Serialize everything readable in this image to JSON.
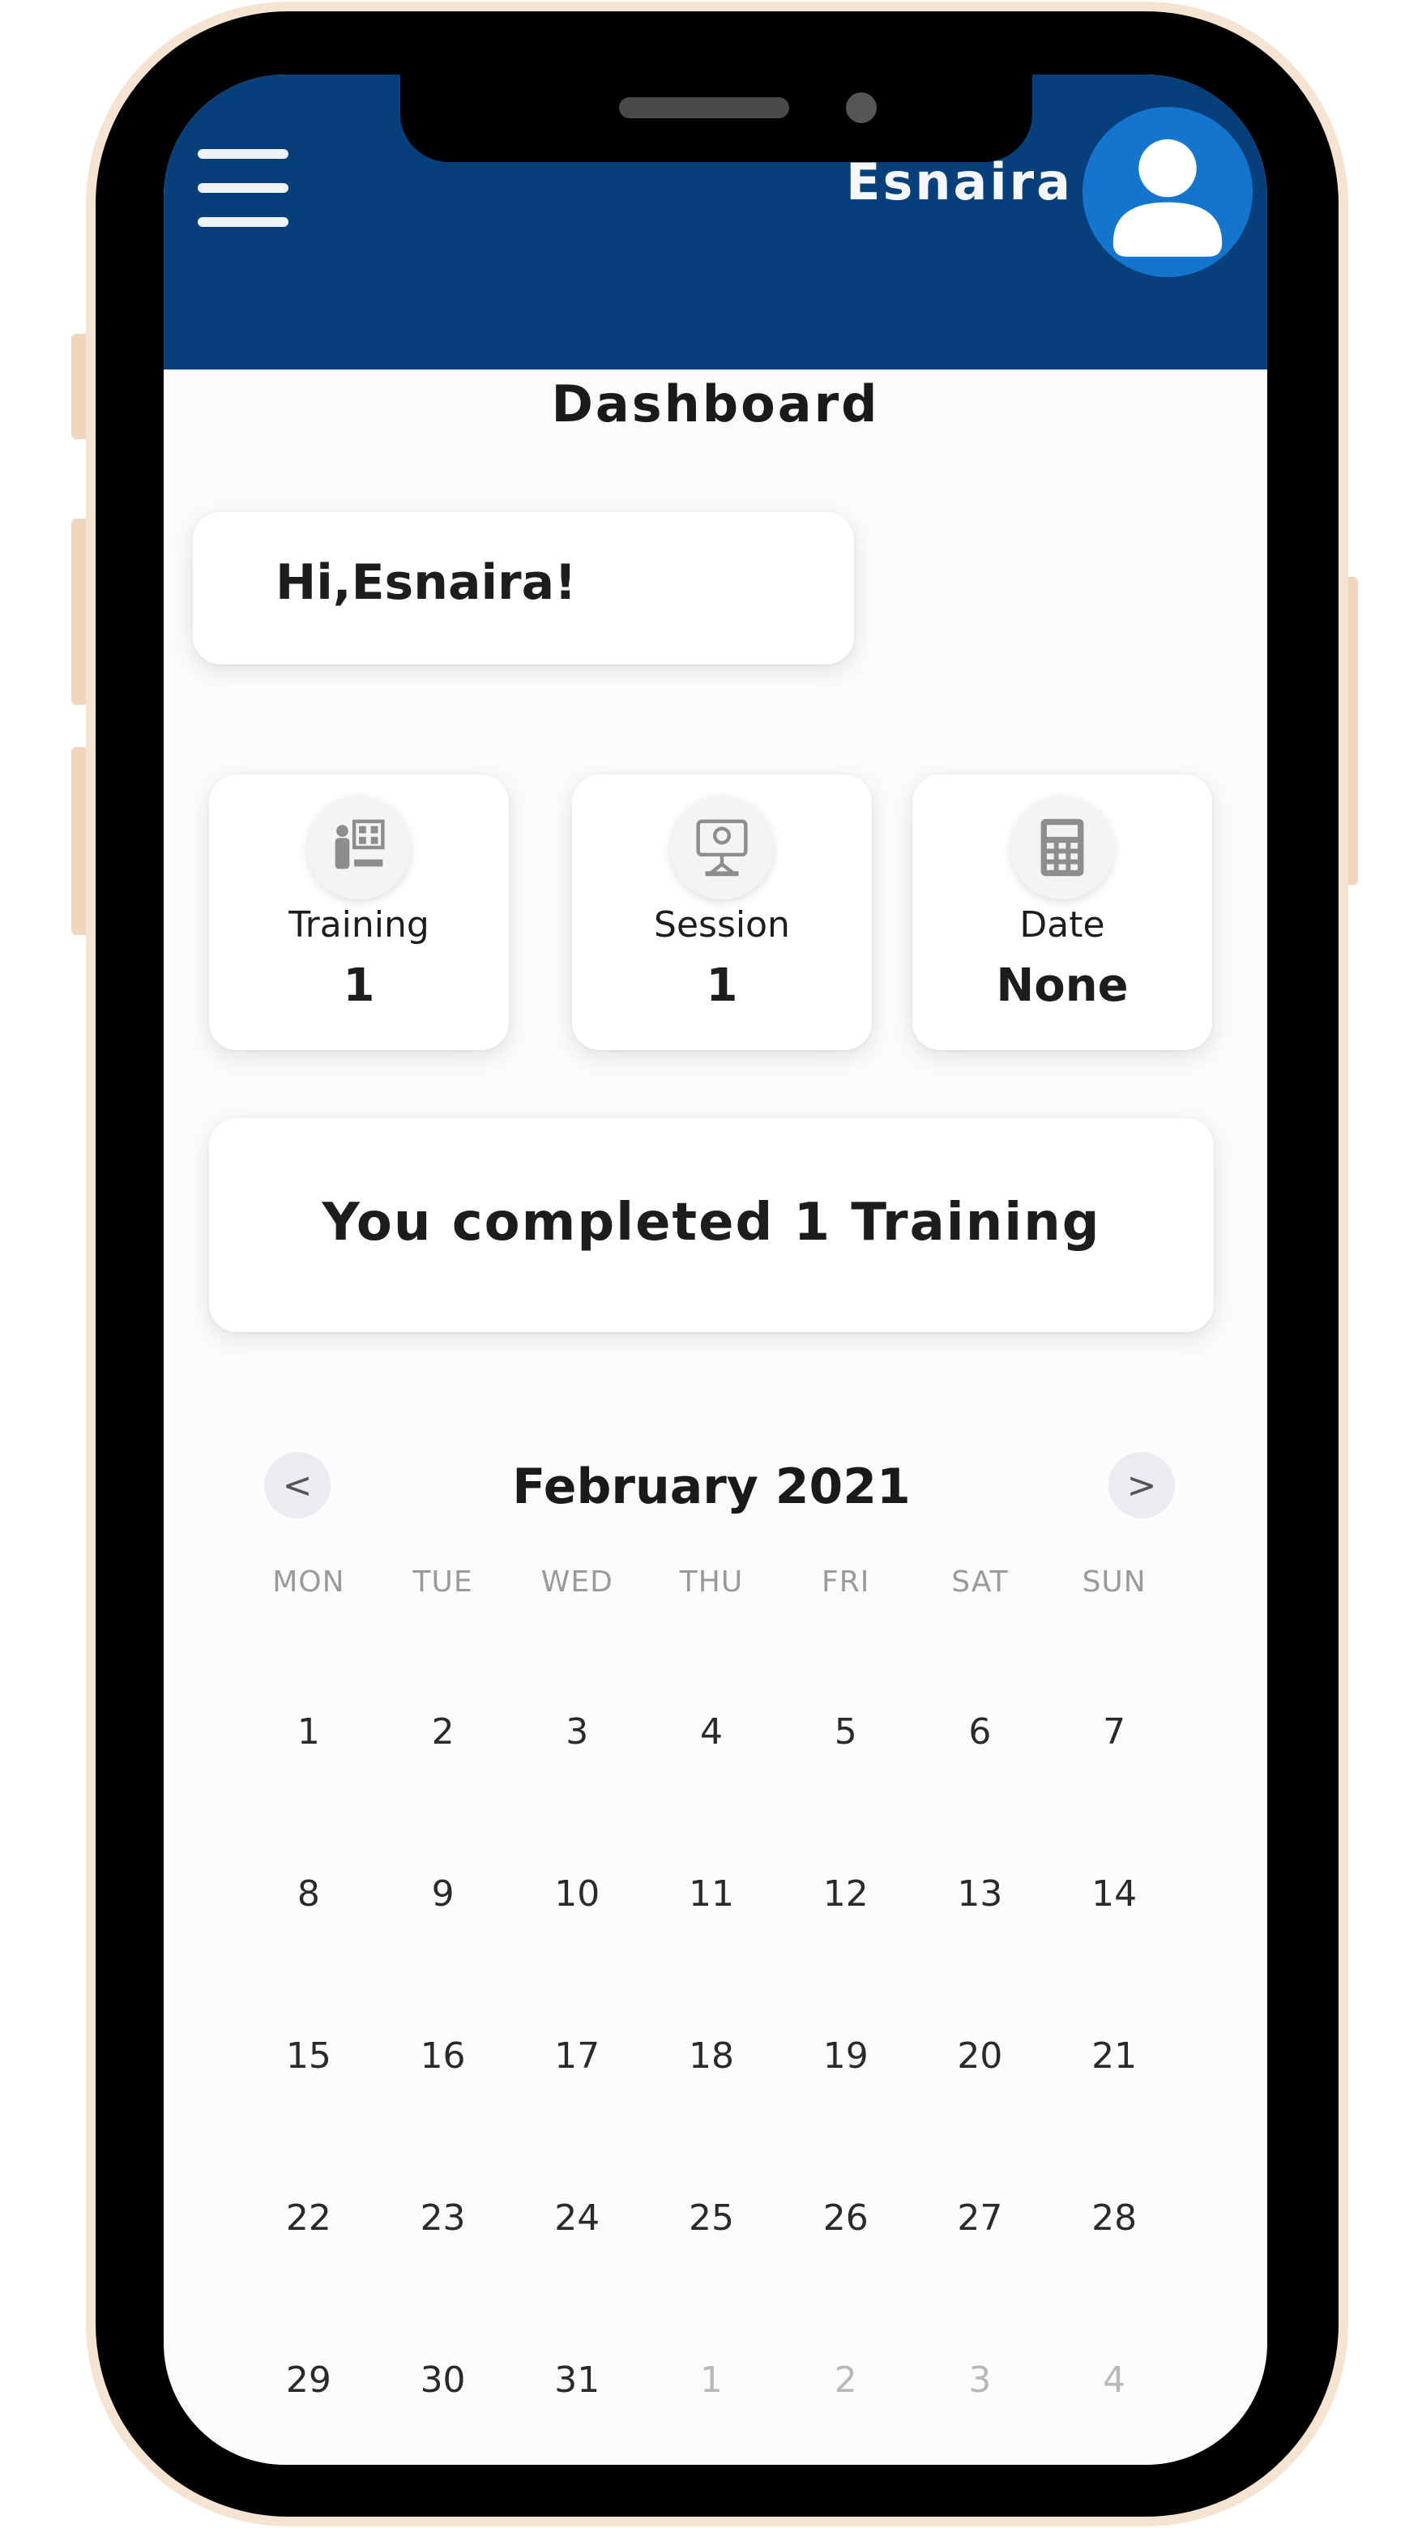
{
  "header": {
    "user_name": "Esnaira",
    "accent_color": "#063f7a",
    "avatar_color": "#1475cf"
  },
  "page": {
    "title": "Dashboard",
    "greeting": "Hi,Esnaira!"
  },
  "stats": [
    {
      "label": "Training",
      "value": "1",
      "icon": "training-icon"
    },
    {
      "label": "Session",
      "value": "1",
      "icon": "session-icon"
    },
    {
      "label": "Date",
      "value": "None",
      "icon": "calculator-icon"
    }
  ],
  "summary": {
    "text": "You completed 1 Training"
  },
  "calendar": {
    "title": "February 2021",
    "prev_symbol": "<",
    "next_symbol": ">",
    "weekdays": [
      "MON",
      "TUE",
      "WED",
      "THU",
      "FRI",
      "SAT",
      "SUN"
    ],
    "days": [
      {
        "label": "1",
        "muted": false
      },
      {
        "label": "2",
        "muted": false
      },
      {
        "label": "3",
        "muted": false
      },
      {
        "label": "4",
        "muted": false
      },
      {
        "label": "5",
        "muted": false
      },
      {
        "label": "6",
        "muted": false
      },
      {
        "label": "7",
        "muted": false
      },
      {
        "label": "8",
        "muted": false
      },
      {
        "label": "9",
        "muted": false
      },
      {
        "label": "10",
        "muted": false
      },
      {
        "label": "11",
        "muted": false
      },
      {
        "label": "12",
        "muted": false
      },
      {
        "label": "13",
        "muted": false
      },
      {
        "label": "14",
        "muted": false
      },
      {
        "label": "15",
        "muted": false
      },
      {
        "label": "16",
        "muted": false
      },
      {
        "label": "17",
        "muted": false
      },
      {
        "label": "18",
        "muted": false
      },
      {
        "label": "19",
        "muted": false
      },
      {
        "label": "20",
        "muted": false
      },
      {
        "label": "21",
        "muted": false
      },
      {
        "label": "22",
        "muted": false
      },
      {
        "label": "23",
        "muted": false
      },
      {
        "label": "24",
        "muted": false
      },
      {
        "label": "25",
        "muted": false
      },
      {
        "label": "26",
        "muted": false
      },
      {
        "label": "27",
        "muted": false
      },
      {
        "label": "28",
        "muted": false
      },
      {
        "label": "29",
        "muted": false
      },
      {
        "label": "30",
        "muted": false
      },
      {
        "label": "31",
        "muted": false
      },
      {
        "label": "1",
        "muted": true
      },
      {
        "label": "2",
        "muted": true
      },
      {
        "label": "3",
        "muted": true
      },
      {
        "label": "4",
        "muted": true
      }
    ]
  }
}
